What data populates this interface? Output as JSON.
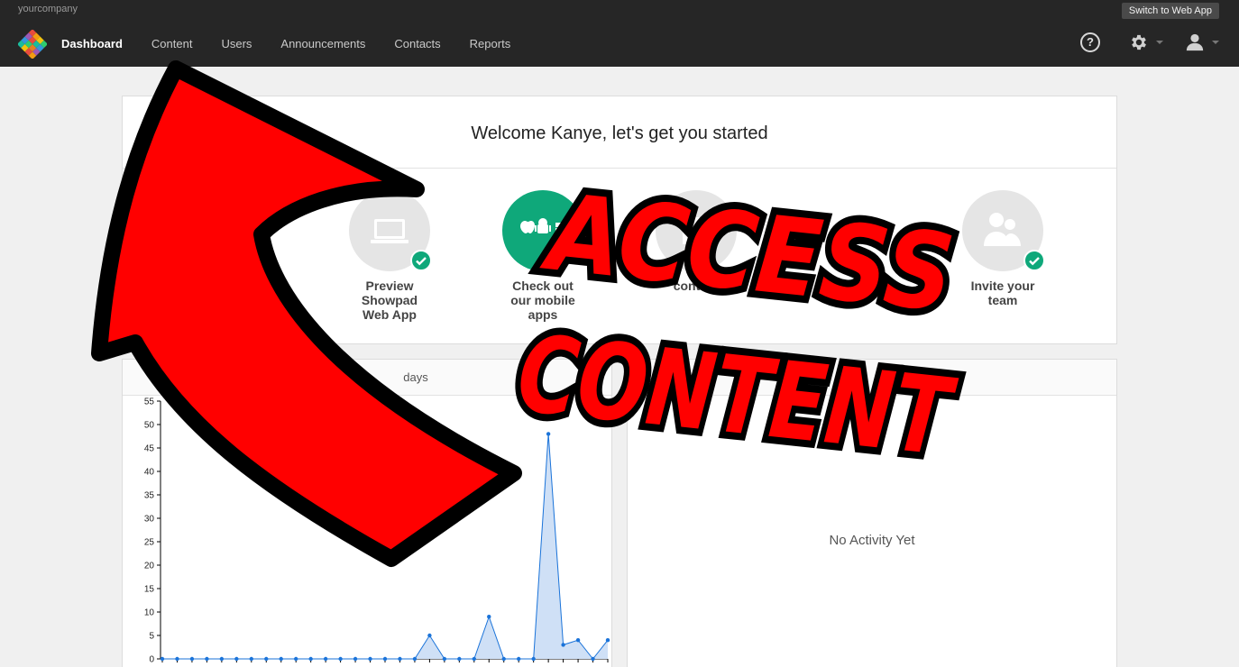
{
  "topbar": {
    "company": "yourcompany",
    "switch_label": "Switch to Web App",
    "nav": [
      {
        "label": "Dashboard",
        "active": true
      },
      {
        "label": "Content",
        "active": false
      },
      {
        "label": "Users",
        "active": false
      },
      {
        "label": "Announcements",
        "active": false
      },
      {
        "label": "Contacts",
        "active": false
      },
      {
        "label": "Reports",
        "active": false
      }
    ],
    "help_glyph": "?"
  },
  "welcome": {
    "title": "Welcome Kanye, let's get you started",
    "steps": [
      {
        "label_lines": [
          "Preview",
          "Showpad",
          "Web App"
        ],
        "icon": "laptop-icon",
        "done": true
      },
      {
        "label_lines": [
          "Check out",
          "our mobile",
          "apps"
        ],
        "icon": "mobile-apps-icon",
        "done": false
      },
      {
        "label_lines": [
          "",
          "content"
        ],
        "icon": "content-icon",
        "done": false
      },
      {
        "label_lines": [
          "Invite your",
          "team"
        ],
        "icon": "team-icon",
        "done": true
      }
    ]
  },
  "chart_header": "days",
  "activity": {
    "empty_text": "No Activity Yet"
  },
  "chart_data": {
    "type": "area",
    "title": "",
    "xlabel": "",
    "ylabel": "",
    "ylim": [
      0,
      55
    ],
    "yticks": [
      0,
      5,
      10,
      15,
      20,
      25,
      30,
      35,
      40,
      45,
      50,
      55
    ],
    "x": [
      0,
      1,
      2,
      3,
      4,
      5,
      6,
      7,
      8,
      9,
      10,
      11,
      12,
      13,
      14,
      15,
      16,
      17,
      18,
      19,
      20,
      21,
      22,
      23,
      24,
      25,
      26,
      27,
      28,
      29,
      30
    ],
    "values": [
      0,
      0,
      0,
      0,
      0,
      0,
      0,
      0,
      0,
      0,
      0,
      0,
      0,
      0,
      0,
      0,
      0,
      0,
      5,
      0,
      0,
      0,
      9,
      0,
      0,
      0,
      48,
      3,
      4,
      0,
      4
    ],
    "color": "#1a73d9",
    "fill": "#cfe0f6"
  },
  "overlay": {
    "line1": "ACCESS",
    "line2": "CONTENT",
    "color": "#ff0000"
  }
}
